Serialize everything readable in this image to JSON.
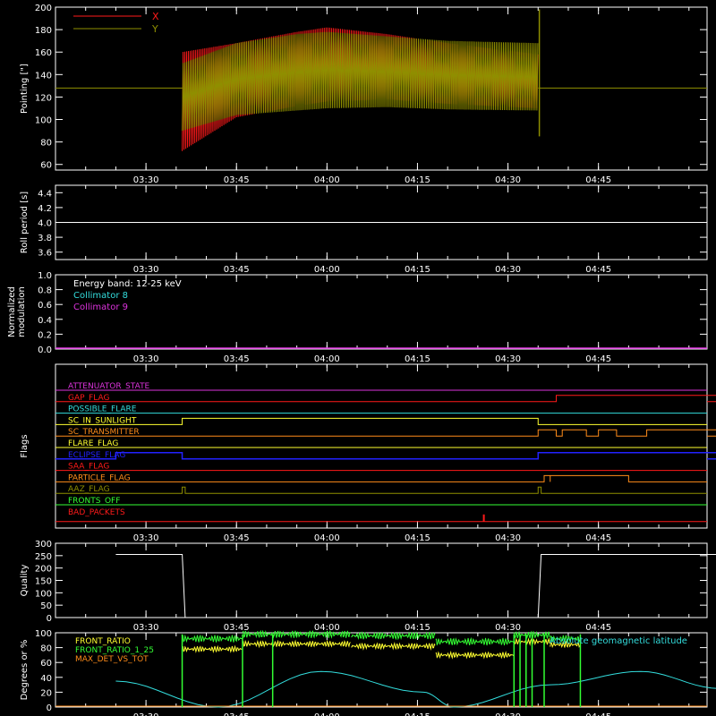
{
  "colors": {
    "background": "#000000",
    "axes": "#ffffff",
    "red": "#ff1a1a",
    "olive": "#8f8f00",
    "yellow": "#ffff30",
    "green": "#33ff33",
    "cyan": "#33dddd",
    "magenta": "#dd33dd",
    "orange": "#ff8c1a",
    "blue": "#2222ff"
  },
  "time_axis": {
    "range_min": [
      3.25,
      5.05
    ],
    "tick_labels": [
      "03:30",
      "03:45",
      "04:00",
      "04:15",
      "04:30",
      "04:45"
    ],
    "tick_values_min": [
      210,
      225,
      240,
      255,
      270,
      285
    ]
  },
  "chart_data": [
    {
      "type": "line",
      "panel": "pointing",
      "ylabel": "Pointing [\"]",
      "ylim": [
        55,
        200
      ],
      "yticks": [
        60,
        80,
        100,
        120,
        140,
        160,
        180,
        200
      ],
      "legend": [
        {
          "name": "X",
          "color": "red"
        },
        {
          "name": "Y",
          "color": "olive"
        }
      ],
      "series": [
        {
          "name": "X",
          "baseline": 128,
          "envelope": [
            {
              "t": "03:36",
              "lo": 72,
              "hi": 160
            },
            {
              "t": "03:45",
              "lo": 102,
              "hi": 168
            },
            {
              "t": "03:55",
              "lo": 112,
              "hi": 178
            },
            {
              "t": "04:00",
              "lo": 116,
              "hi": 182
            },
            {
              "t": "04:10",
              "lo": 118,
              "hi": 176
            },
            {
              "t": "04:20",
              "lo": 114,
              "hi": 168
            },
            {
              "t": "04:35",
              "lo": 110,
              "hi": 158
            }
          ]
        },
        {
          "name": "Y",
          "baseline": 128,
          "envelope": [
            {
              "t": "03:36",
              "lo": 90,
              "hi": 150
            },
            {
              "t": "03:45",
              "lo": 104,
              "hi": 168
            },
            {
              "t": "03:55",
              "lo": 108,
              "hi": 176
            },
            {
              "t": "04:00",
              "lo": 110,
              "hi": 178
            },
            {
              "t": "04:10",
              "lo": 111,
              "hi": 174
            },
            {
              "t": "04:20",
              "lo": 109,
              "hi": 170
            },
            {
              "t": "04:35",
              "lo": 108,
              "hi": 168
            }
          ]
        }
      ]
    },
    {
      "type": "line",
      "panel": "roll",
      "ylabel": "Roll period [s]",
      "ylim": [
        3.5,
        4.5
      ],
      "yticks": [
        "3.6",
        "3.8",
        "4.0",
        "4.2",
        "4.4"
      ],
      "series": [
        {
          "value": 4.0,
          "color": "#ffffff"
        }
      ]
    },
    {
      "type": "line",
      "panel": "modulation",
      "ylabel": [
        "Normalized",
        "modulation"
      ],
      "ylim": [
        0,
        1
      ],
      "yticks": [
        "0.0",
        "0.2",
        "0.4",
        "0.6",
        "0.8",
        "1.0"
      ],
      "annotations": [
        {
          "text": "Energy band: 12-25 keV",
          "color": "white"
        },
        {
          "text": "Collimator 8",
          "color": "cyan"
        },
        {
          "text": "Collimator 9",
          "color": "magenta"
        }
      ],
      "series": [
        {
          "name": "Collimator 9",
          "value": 0.0,
          "color": "magenta"
        }
      ]
    },
    {
      "type": "line",
      "panel": "flags",
      "ylabel": "Flags",
      "flags": [
        {
          "name": "ATTENUATOR_STATE",
          "color": "magenta",
          "steps": []
        },
        {
          "name": "GAP_FLAG",
          "color": "red",
          "steps": [
            [
              "04:38",
              "05:05"
            ]
          ]
        },
        {
          "name": "POSSIBLE_FLARE",
          "color": "cyan",
          "steps": []
        },
        {
          "name": "SC_IN_SUNLIGHT",
          "color": "yellow",
          "steps": [
            [
              "03:36",
              "04:35"
            ]
          ]
        },
        {
          "name": "SC_TRANSMITTER",
          "color": "orange",
          "steps": [
            [
              "04:35",
              "04:38"
            ],
            [
              "04:39",
              "04:43"
            ],
            [
              "04:45",
              "04:48"
            ],
            [
              "04:53",
              "05:05"
            ]
          ]
        },
        {
          "name": "FLARE_FLAG",
          "color": "yellow",
          "steps": []
        },
        {
          "name": "ECLIPSE_FLAG",
          "color": "blue",
          "steps": [
            [
              "03:25",
              "03:36"
            ],
            [
              "04:35",
              "05:05"
            ]
          ]
        },
        {
          "name": "SAA_FLAG",
          "color": "red",
          "steps": []
        },
        {
          "name": "PARTICLE_FLAG",
          "color": "orange",
          "steps": [
            [
              "04:36",
              "04:37"
            ],
            [
              "04:37",
              "04:50"
            ]
          ]
        },
        {
          "name": "AAZ_FLAG",
          "color": "olive",
          "steps": [
            [
              "03:36",
              "03:36.5"
            ],
            [
              "04:35",
              "04:35.5"
            ]
          ]
        },
        {
          "name": "FRONTS_OFF",
          "color": "green",
          "steps": []
        },
        {
          "name": "BAD_PACKETS",
          "color": "red",
          "spikes": [
            "04:26"
          ]
        }
      ]
    },
    {
      "type": "line",
      "panel": "quality",
      "ylabel": "Quality",
      "ylim": [
        0,
        300
      ],
      "yticks": [
        "0",
        "50",
        "100",
        "150",
        "200",
        "250",
        "300"
      ],
      "series": [
        {
          "points": [
            [
              "03:25",
              255
            ],
            [
              "03:36",
              255
            ],
            [
              "03:36.5",
              0
            ],
            [
              "04:35",
              0
            ],
            [
              "04:35.5",
              255
            ],
            [
              "05:05",
              255
            ]
          ]
        }
      ]
    },
    {
      "type": "line",
      "panel": "ratios",
      "ylabel": "Degrees or %",
      "ylim": [
        0,
        100
      ],
      "yticks": [
        "0",
        "20",
        "40",
        "60",
        "80",
        "100"
      ],
      "legend_left": [
        {
          "name": "FRONT_RATIO",
          "color": "yellow"
        },
        {
          "name": "FRONT_RATIO_1_25",
          "color": "green"
        },
        {
          "name": "MAX_DET_VS_TOT",
          "color": "orange"
        }
      ],
      "legend_right": {
        "name": "Absolute geomagnetic latitude",
        "color": "cyan"
      },
      "series": [
        {
          "name": "FRONT_RATIO",
          "color": "yellow",
          "segments": [
            {
              "t0": "03:36",
              "t1": "03:46",
              "v": 78
            },
            {
              "t0": "03:46",
              "t1": "04:04",
              "v": 85
            },
            {
              "t0": "04:04",
              "t1": "04:18",
              "v": 82
            },
            {
              "t0": "04:18",
              "t1": "04:31",
              "v": 70
            },
            {
              "t0": "04:31",
              "t1": "04:37",
              "v": 88
            },
            {
              "t0": "04:37",
              "t1": "04:42",
              "v": 84
            }
          ]
        },
        {
          "name": "FRONT_RATIO_1_25",
          "color": "green",
          "segments": [
            {
              "t0": "03:36",
              "t1": "03:46",
              "v": 92
            },
            {
              "t0": "03:46",
              "t1": "04:04",
              "v": 98
            },
            {
              "t0": "04:04",
              "t1": "04:18",
              "v": 96
            },
            {
              "t0": "04:18",
              "t1": "04:31",
              "v": 88
            },
            {
              "t0": "04:31",
              "t1": "04:37",
              "v": 97
            },
            {
              "t0": "04:37",
              "t1": "04:42",
              "v": 92
            }
          ],
          "drops": [
            "03:36",
            "03:46",
            "03:51",
            "04:31",
            "04:32",
            "04:33",
            "04:34",
            "04:36",
            "04:42"
          ]
        },
        {
          "name": "MAX_DET_VS_TOT",
          "color": "orange",
          "value": 0
        },
        {
          "name": "Absolute geomagnetic latitude",
          "color": "cyan",
          "points": [
            [
              "03:25",
              35
            ],
            [
              "03:42",
              0
            ],
            [
              "03:59",
              48
            ],
            [
              "04:16",
              20
            ],
            [
              "04:21",
              0
            ],
            [
              "04:37",
              30
            ],
            [
              "04:52",
              48
            ],
            [
              "05:05",
              25
            ]
          ]
        }
      ]
    }
  ]
}
